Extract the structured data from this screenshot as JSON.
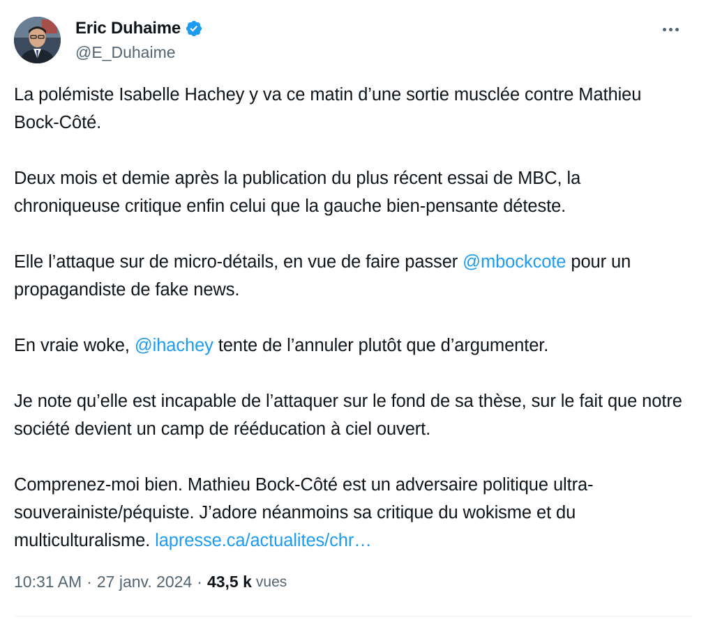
{
  "author": {
    "display_name": "Eric Duhaime",
    "handle": "@E_Duhaime",
    "verified_badge_color": "#1d9bf0"
  },
  "icons": {
    "verified": "verified-badge-icon",
    "more": "more-options-icon",
    "avatar": "profile-avatar"
  },
  "tweet": {
    "p1": "La polémiste Isabelle Hachey y va ce matin d’une sortie musclée contre Mathieu Bock-Côté.",
    "p2": "Deux mois et demie après la publication du plus récent essai de MBC, la chroniqueuse critique enfin celui que la gauche bien-pensante déteste.",
    "p3_before": "Elle l’attaque sur de micro-détails, en vue de faire passer ",
    "p3_mention": "@mbockcote",
    "p3_after": " pour un propagandiste de fake news.",
    "p4_before": "En vraie woke, ",
    "p4_mention": "@ihachey",
    "p4_after": " tente de l’annuler plutôt que d’argumenter.",
    "p5": "Je note qu’elle est incapable de l’attaquer sur le fond de sa thèse, sur le fait que notre société devient un camp de rééducation à ciel ouvert.",
    "p6_text": "Comprenez-moi bien. Mathieu Bock-Côté est un adversaire politique ultra-souverainiste/péquiste. J’adore néanmoins sa critique du wokisme et du multiculturalisme. ",
    "p6_link": "lapresse.ca/actualites/chr…"
  },
  "meta": {
    "time": "10:31 AM",
    "separator": "·",
    "date": "27 janv. 2024",
    "views_count": "43,5 k",
    "views_label": "vues"
  },
  "colors": {
    "link": "#1d9bf0",
    "text": "#0f1419",
    "secondary": "#536471"
  }
}
